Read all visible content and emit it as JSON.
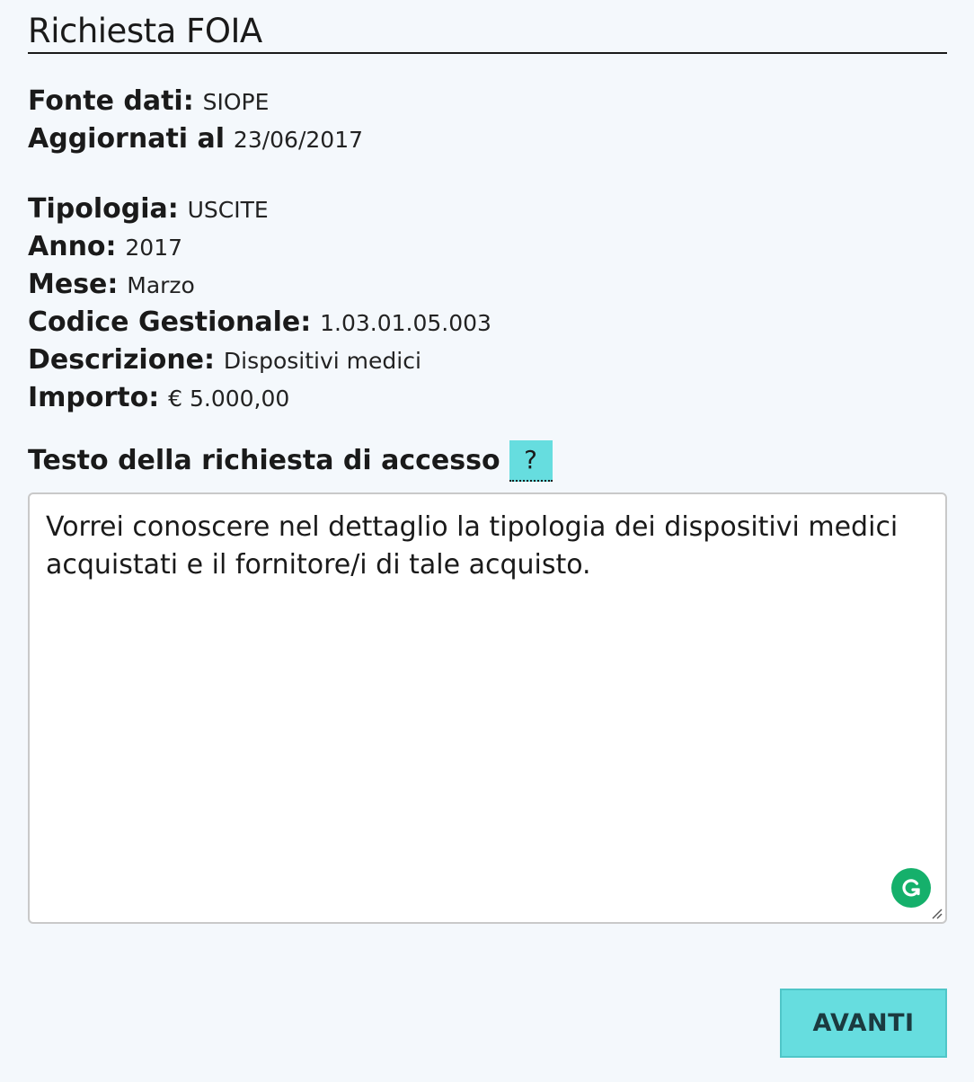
{
  "page": {
    "title": "Richiesta FOIA"
  },
  "source": {
    "source_label": "Fonte dati:",
    "source_value": "SIOPE",
    "updated_label": "Aggiornati al",
    "updated_value": "23/06/2017"
  },
  "details": {
    "type_label": "Tipologia:",
    "type_value": "USCITE",
    "year_label": "Anno:",
    "year_value": "2017",
    "month_label": "Mese:",
    "month_value": "Marzo",
    "code_label": "Codice Gestionale:",
    "code_value": "1.03.01.05.003",
    "description_label": "Descrizione:",
    "description_value": "Dispositivi medici",
    "amount_label": "Importo:",
    "amount_value": "€ 5.000,00"
  },
  "request": {
    "heading": "Testo della richiesta di accesso",
    "help_label": "?",
    "text": "Vorrei conoscere nel dettaglio la tipologia dei dispositivi medici acquistati e il fornitore/i di tale acquisto."
  },
  "actions": {
    "next_label": "AVANTI"
  },
  "colors": {
    "accent": "#66dddf",
    "background": "#f4f8fc",
    "grammarly": "#15b06b"
  },
  "icons": {
    "grammarly": "grammarly-icon",
    "resize": "resize-handle-icon"
  }
}
